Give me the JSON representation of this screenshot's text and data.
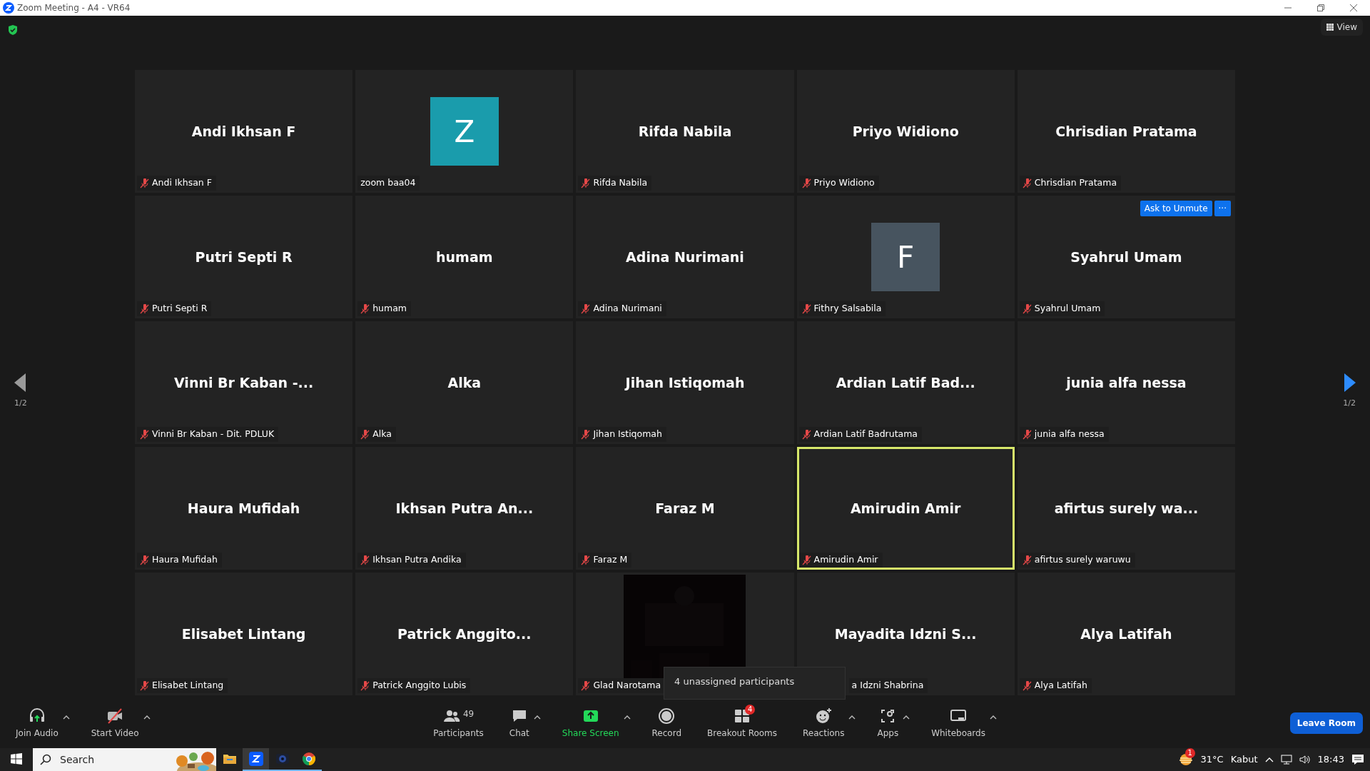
{
  "window": {
    "title": "Zoom Meeting - A4 - VR64"
  },
  "top": {
    "view_button": "View"
  },
  "pager": {
    "left": "1/2",
    "right": "1/2"
  },
  "tiles": [
    {
      "kind": "name",
      "display": "Andi Ikhsan F",
      "label": "Andi Ikhsan F",
      "muted": true,
      "active": false
    },
    {
      "kind": "avatar",
      "display": "Z",
      "color": "#1a9cac",
      "label": "zoom baa04",
      "muted": false,
      "active": false
    },
    {
      "kind": "name",
      "display": "Rifda Nabila",
      "label": "Rifda Nabila",
      "muted": true,
      "active": false
    },
    {
      "kind": "name",
      "display": "Priyo Widiono",
      "label": "Priyo Widiono",
      "muted": true,
      "active": false
    },
    {
      "kind": "name",
      "display": "Chrisdian Pratama",
      "label": "Chrisdian Pratama",
      "muted": true,
      "active": false
    },
    {
      "kind": "name",
      "display": "Putri Septi R",
      "label": "Putri Septi R",
      "muted": true,
      "active": false
    },
    {
      "kind": "name",
      "display": "humam",
      "label": "humam",
      "muted": true,
      "active": false
    },
    {
      "kind": "name",
      "display": "Adina Nurimani",
      "label": "Adina Nurimani",
      "muted": true,
      "active": false
    },
    {
      "kind": "avatar",
      "display": "F",
      "color": "#47545f",
      "label": "Fithry Salsabila",
      "muted": true,
      "active": false
    },
    {
      "kind": "name",
      "display": "Syahrul Umam",
      "label": "Syahrul Umam",
      "muted": true,
      "active": false,
      "actions": [
        "Ask to Unmute",
        "···"
      ]
    },
    {
      "kind": "name",
      "display": "Vinni Br Kaban -...",
      "label": "Vinni Br Kaban - Dit. PDLUK",
      "muted": true,
      "active": false
    },
    {
      "kind": "name",
      "display": "Alka",
      "label": "Alka",
      "muted": true,
      "active": false
    },
    {
      "kind": "name",
      "display": "Jihan Istiqomah",
      "label": "Jihan Istiqomah",
      "muted": true,
      "active": false
    },
    {
      "kind": "name",
      "display": "Ardian Latif Bad...",
      "label": "Ardian Latif Badrutama",
      "muted": true,
      "active": false
    },
    {
      "kind": "name",
      "display": "junia alfa nessa",
      "label": "junia alfa nessa",
      "muted": true,
      "active": false
    },
    {
      "kind": "name",
      "display": "Haura Mufidah",
      "label": "Haura Mufidah",
      "muted": true,
      "active": false
    },
    {
      "kind": "name",
      "display": "Ikhsan Putra An...",
      "label": "Ikhsan Putra Andika",
      "muted": true,
      "active": false
    },
    {
      "kind": "name",
      "display": "Faraz M",
      "label": "Faraz M",
      "muted": true,
      "active": false
    },
    {
      "kind": "name",
      "display": "Amirudin Amir",
      "label": "Amirudin Amir",
      "muted": true,
      "active": true
    },
    {
      "kind": "name",
      "display": "afirtus surely wa...",
      "label": "afirtus surely waruwu",
      "muted": true,
      "active": false
    },
    {
      "kind": "name",
      "display": "Elisabet Lintang",
      "label": "Elisabet Lintang",
      "muted": true,
      "active": false
    },
    {
      "kind": "name",
      "display": "Patrick Anggito...",
      "label": "Patrick Anggito Lubis",
      "muted": true,
      "active": false
    },
    {
      "kind": "video",
      "label": "Glad Narotama",
      "muted": true,
      "active": false
    },
    {
      "kind": "name",
      "display": "Mayadita Idzni S...",
      "label": "a Idzni Shabrina",
      "partly_hidden": true,
      "active": false
    },
    {
      "kind": "name",
      "display": "Alya Latifah",
      "label": "Alya Latifah",
      "muted": true,
      "active": false
    }
  ],
  "tooltip": "4 unassigned participants",
  "toolbar": {
    "left": [
      {
        "kind": "audio",
        "label": "Join Audio",
        "caret": true
      },
      {
        "kind": "video",
        "label": "Start Video",
        "caret": true
      }
    ],
    "center": [
      {
        "kind": "participants",
        "label": "Participants",
        "count": "49",
        "caret": false
      },
      {
        "kind": "chat",
        "label": "Chat",
        "caret": true
      },
      {
        "kind": "share",
        "label": "Share Screen",
        "caret": true
      },
      {
        "kind": "record",
        "label": "Record",
        "caret": false
      },
      {
        "kind": "breakout",
        "label": "Breakout Rooms",
        "badge": "4",
        "caret": false
      },
      {
        "kind": "reactions",
        "label": "Reactions",
        "caret": true
      },
      {
        "kind": "apps",
        "label": "Apps",
        "caret": true
      },
      {
        "kind": "whiteboards",
        "label": "Whiteboards",
        "caret": true
      }
    ],
    "leave": "Leave Room"
  },
  "taskbar": {
    "search": {
      "placeholder": "Search"
    },
    "apps": [
      {
        "kind": "explorer",
        "selected": false,
        "running": false
      },
      {
        "kind": "zoom",
        "selected": true,
        "running": true
      },
      {
        "kind": "camera",
        "selected": false,
        "running": true
      },
      {
        "kind": "chrome",
        "selected": false,
        "running": true
      }
    ],
    "weather": {
      "badge": "1",
      "temperature": "31°C",
      "condition": "Kabut"
    },
    "time": "18:43"
  }
}
